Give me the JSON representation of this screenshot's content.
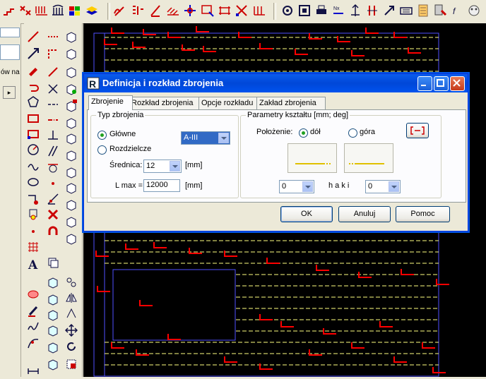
{
  "toolbar": {
    "icons": [
      "stairs-icon",
      "repeat-icon",
      "dimension-icon",
      "columns-icon",
      "palette-icon",
      "layers-icon",
      "pencil-curve-icon",
      "tick-marks-icon",
      "slash-icon",
      "hatch-icon",
      "move-cross-icon",
      "zoom-window-icon",
      "stretch-icon",
      "trim-icon",
      "grid-icon",
      "snap-icon",
      "box-icon",
      "print-icon",
      "normal-icon",
      "vertical-arrows-icon",
      "ij-icon",
      "arrow-icon",
      "keyboard-icon",
      "settings-icon",
      "calculator-icon",
      "properties-icon",
      "fx-icon",
      "mask-icon"
    ]
  },
  "left_panel": {
    "text": "ów na",
    "arrow": "▸"
  },
  "dialog": {
    "title": "Definicja i rozkład zbrojenia",
    "tabs": [
      "Zbrojenie",
      "Rozkład zbrojenia",
      "Opcje rozkładu",
      "Zakład zbrojenia"
    ],
    "typ_group": {
      "label": "Typ zbrojenia",
      "radio_main": "Główne",
      "radio_dist": "Rozdzielcze",
      "steel_value": "A-III",
      "diameter_label": "Średnica:",
      "diameter_value": "12",
      "diameter_unit": "[mm]",
      "lmax_label": "L max =",
      "lmax_value": "12000",
      "lmax_unit": "[mm]"
    },
    "shape_group": {
      "label": "Parametry kształtu  [mm; deg]",
      "position_label": "Położenie:",
      "radio_bottom": "dół",
      "radio_top": "góra",
      "combo_left": "0",
      "hooks_label": "h a k i",
      "combo_right": "0"
    },
    "buttons": {
      "ok": "OK",
      "cancel": "Anuluj",
      "help": "Pomoc"
    }
  },
  "colors": {
    "canvas": "#000000",
    "rebar": "#ff0000",
    "dash": "#ffff80",
    "frame": "#5050ff"
  }
}
